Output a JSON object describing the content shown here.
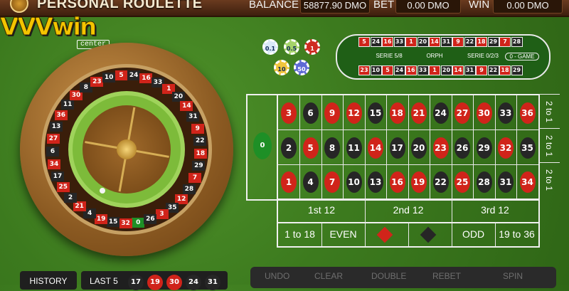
{
  "header": {
    "title": "PERSONAL ROULETTE",
    "balance_label": "BALANCE",
    "balance_value": "58877.90 DMO",
    "bet_label": "BET",
    "bet_value": "0.00 DMO",
    "win_label": "WIN",
    "win_value": "0.00 DMO"
  },
  "logo": {
    "brand": "VVVwin",
    "sub": "center"
  },
  "chips": [
    "0.1",
    "0.5",
    "1",
    "10",
    "50"
  ],
  "racetrack": {
    "top": [
      "5",
      "24",
      "16",
      "33",
      "1",
      "20",
      "14",
      "31",
      "9",
      "22",
      "18",
      "29",
      "7",
      "28"
    ],
    "bottom": [
      "23",
      "10",
      "5",
      "24",
      "16",
      "33",
      "1",
      "20",
      "14",
      "31",
      "9",
      "22",
      "18",
      "29"
    ],
    "ends": [
      "15",
      "35",
      "3",
      "12",
      "26",
      "0",
      "32",
      "4",
      "21",
      "2",
      "25"
    ],
    "sections": [
      "SERIE 5/8",
      "ORPH",
      "SERIE 0/2/3",
      "0 - GAME"
    ]
  },
  "table": {
    "zero": "0",
    "rows": [
      [
        "3",
        "6",
        "9",
        "12",
        "15",
        "18",
        "21",
        "24",
        "27",
        "30",
        "33",
        "36"
      ],
      [
        "2",
        "5",
        "8",
        "11",
        "14",
        "17",
        "20",
        "23",
        "26",
        "29",
        "32",
        "35"
      ],
      [
        "1",
        "4",
        "7",
        "10",
        "13",
        "16",
        "19",
        "22",
        "25",
        "28",
        "31",
        "34"
      ]
    ],
    "column_bets": [
      "2 to 1",
      "2 to 1",
      "2 to 1"
    ],
    "dozens": [
      "1st 12",
      "2nd 12",
      "3rd 12"
    ],
    "outside": [
      "1 to 18",
      "EVEN",
      "",
      "",
      "ODD",
      "19 to 36"
    ],
    "red_numbers": [
      "1",
      "3",
      "5",
      "7",
      "9",
      "12",
      "14",
      "16",
      "18",
      "19",
      "21",
      "23",
      "25",
      "27",
      "30",
      "32",
      "34",
      "36"
    ],
    "colors": {
      "red": "#d0241a",
      "black": "#262626",
      "green": "#1e8f26"
    }
  },
  "wheel": {
    "numbers": [
      "0",
      "32",
      "15",
      "19",
      "4",
      "21",
      "2",
      "25",
      "17",
      "34",
      "6",
      "27",
      "13",
      "36",
      "11",
      "30",
      "8",
      "23",
      "10",
      "5",
      "24",
      "16",
      "33",
      "1",
      "20",
      "14",
      "31",
      "9",
      "22",
      "18",
      "29",
      "7",
      "28",
      "12",
      "35",
      "3",
      "26"
    ]
  },
  "bottom": {
    "history_label": "HISTORY",
    "last5_label": "LAST 5",
    "last5": [
      "17",
      "19",
      "30",
      "24",
      "31"
    ],
    "controls": [
      "UNDO",
      "CLEAR",
      "DOUBLE",
      "REBET",
      "SPIN"
    ]
  }
}
